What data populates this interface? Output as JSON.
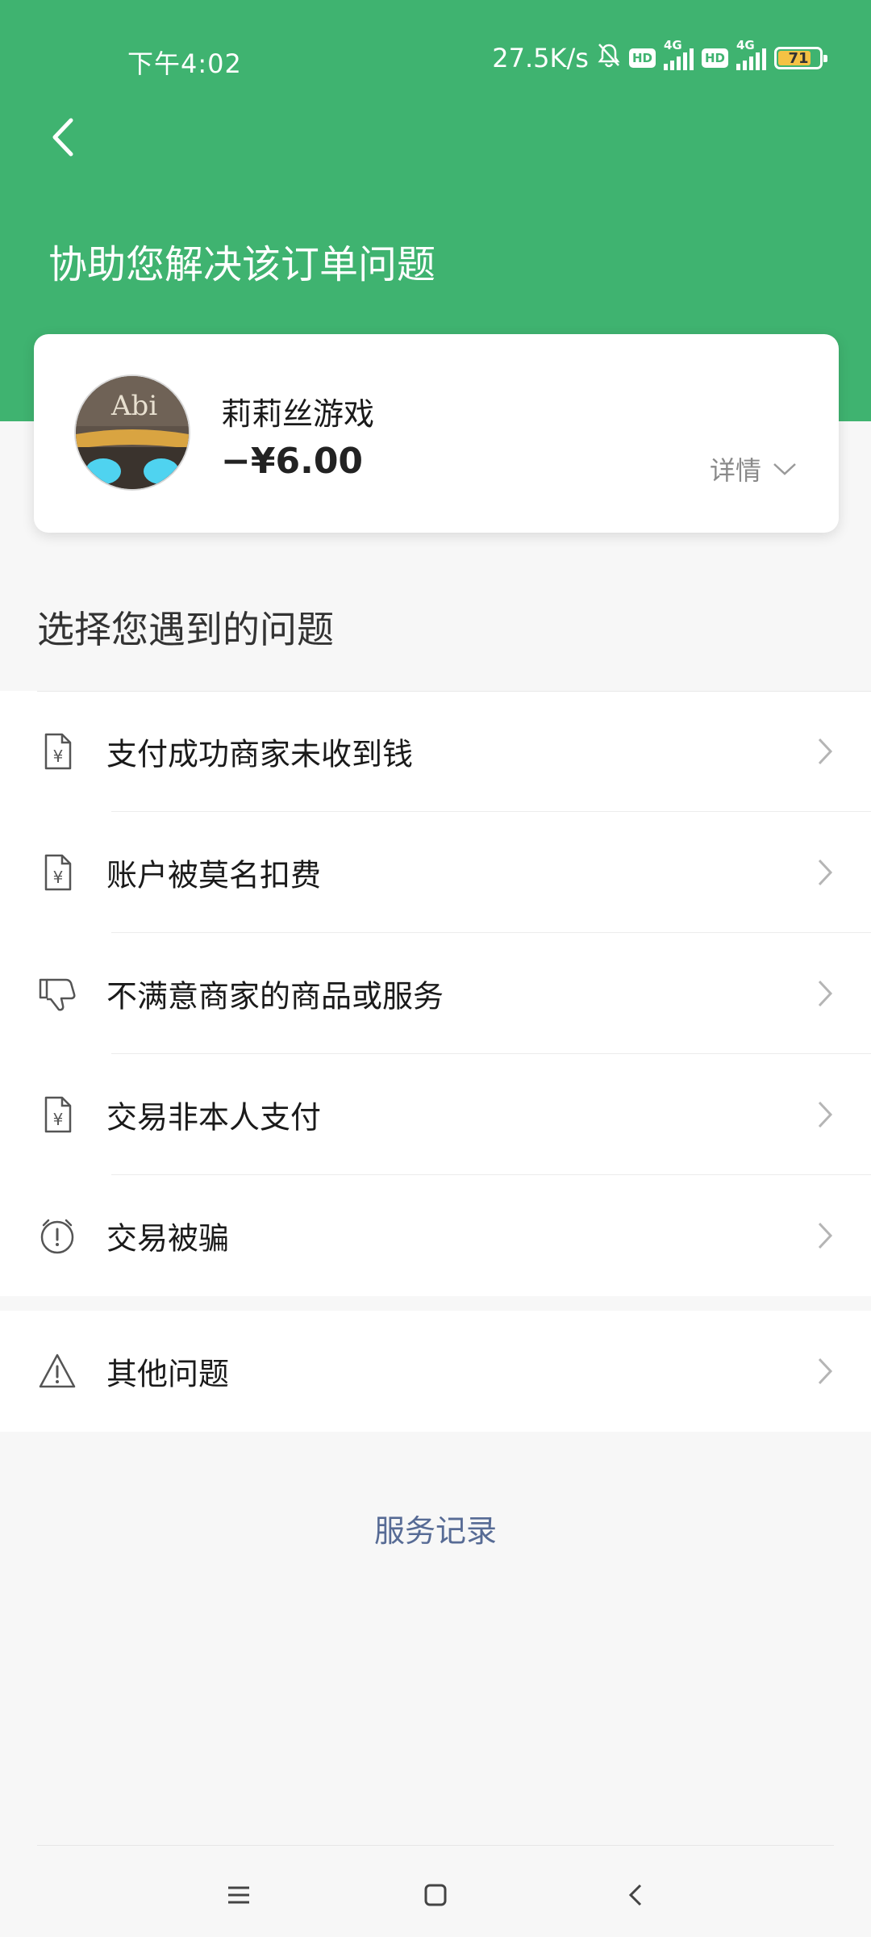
{
  "status_bar": {
    "time": "下午4:02",
    "network_speed": "27.5K/s",
    "hd_label": "HD",
    "signal_label": "4G",
    "battery_level": "71"
  },
  "header": {
    "title": "协助您解决该订单问题",
    "accent_color": "#3fb370"
  },
  "order": {
    "merchant_name": "莉莉丝游戏",
    "amount": "−¥6.00",
    "detail_label": "详情"
  },
  "problems": {
    "section_title": "选择您遇到的问题",
    "items": [
      {
        "label": "支付成功商家未收到钱",
        "icon": "yuan-document-icon"
      },
      {
        "label": "账户被莫名扣费",
        "icon": "yuan-document-icon"
      },
      {
        "label": "不满意商家的商品或服务",
        "icon": "thumbs-down-icon"
      },
      {
        "label": "交易非本人支付",
        "icon": "yuan-document-icon"
      },
      {
        "label": "交易被骗",
        "icon": "alarm-alert-icon"
      }
    ],
    "other": {
      "label": "其他问题",
      "icon": "warning-triangle-icon"
    }
  },
  "footer": {
    "service_record": "服务记录",
    "link_color": "#576b95"
  }
}
